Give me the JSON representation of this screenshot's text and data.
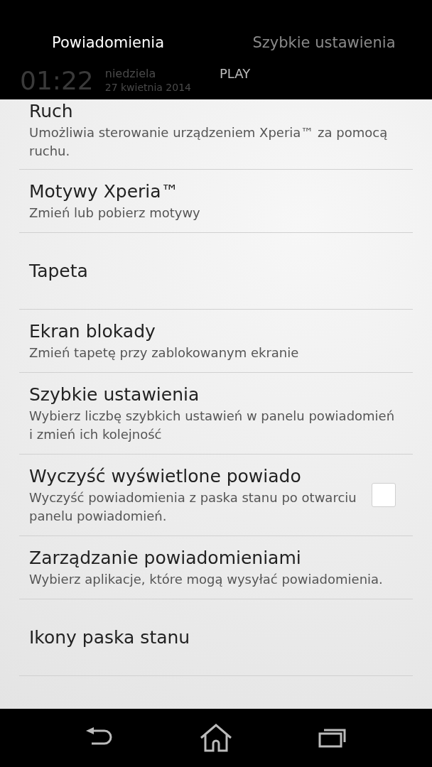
{
  "tabs": [
    {
      "label": "Powiadomienia",
      "selected": true
    },
    {
      "label": "Szybkie ustawienia",
      "selected": false
    }
  ],
  "clock": {
    "time": "01:22",
    "day": "niedziela",
    "date": "27 kwietnia 2014",
    "carrier": "PLAY"
  },
  "settings": [
    {
      "kind": "plain",
      "title": "Ruch",
      "summary": "Umożliwia sterowanie urządzeniem Xperia™ za pomocą ruchu."
    },
    {
      "kind": "plain",
      "title": "Motywy Xperia™",
      "summary": "Zmień lub pobierz motywy"
    },
    {
      "kind": "plain",
      "title": "Tapeta"
    },
    {
      "kind": "plain",
      "title": "Ekran blokady",
      "summary": "Zmień tapetę przy zablokowanym ekranie"
    },
    {
      "kind": "plain",
      "title": "Szybkie ustawienia",
      "summary": "Wybierz liczbę szybkich ustawień w panelu powiadomień i zmień ich kolejność"
    },
    {
      "kind": "checkbox",
      "title": "Wyczyść wyświetlone powiado",
      "summary": "Wyczyść powiadomienia z paska stanu po otwarciu panelu powiadomień.",
      "checked": false
    },
    {
      "kind": "plain",
      "title": "Zarządzanie powiadomieniami",
      "summary": "Wybierz aplikacje, które mogą wysyłać powiadomienia."
    },
    {
      "kind": "plain",
      "title": "Ikony paska stanu"
    }
  ]
}
